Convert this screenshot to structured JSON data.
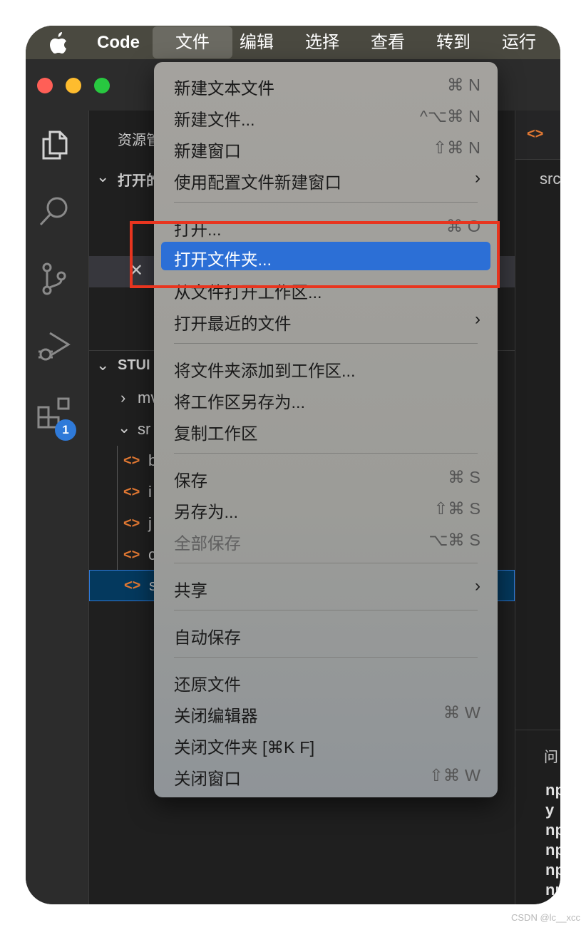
{
  "menubar": {
    "app_name": "Code",
    "items": [
      "文件",
      "编辑",
      "选择",
      "查看",
      "转到",
      "运行"
    ]
  },
  "sidebar": {
    "header": "资源管",
    "open_editors": "打开的",
    "workspace": "STUI",
    "folders": [
      "mv",
      "sr"
    ],
    "files": [
      "b",
      "i",
      "j",
      "c",
      "s"
    ],
    "badge_count": "1"
  },
  "editor": {
    "breadcrumb": "src",
    "panel_label": "问",
    "terminal_lines": [
      "np",
      "y",
      "np",
      "np",
      "np",
      "np"
    ]
  },
  "menu": {
    "items": [
      {
        "label": "新建文本文件",
        "shortcut": "⌘ N"
      },
      {
        "label": "新建文件...",
        "shortcut": "^⌥⌘ N"
      },
      {
        "label": "新建窗口",
        "shortcut": "⇧⌘ N"
      },
      {
        "label": "使用配置文件新建窗口",
        "shortcut": ""
      },
      {
        "label": "打开...",
        "shortcut": "⌘ O"
      },
      {
        "label": "打开文件夹...",
        "shortcut": ""
      },
      {
        "label": "从文件打开工作区...",
        "shortcut": ""
      },
      {
        "label": "打开最近的文件",
        "shortcut": ""
      },
      {
        "label": "将文件夹添加到工作区...",
        "shortcut": ""
      },
      {
        "label": "将工作区另存为...",
        "shortcut": ""
      },
      {
        "label": "复制工作区",
        "shortcut": ""
      },
      {
        "label": "保存",
        "shortcut": "⌘ S"
      },
      {
        "label": "另存为...",
        "shortcut": "⇧⌘ S"
      },
      {
        "label": "全部保存",
        "shortcut": "⌥⌘ S"
      },
      {
        "label": "共享",
        "shortcut": ""
      },
      {
        "label": "自动保存",
        "shortcut": ""
      },
      {
        "label": "还原文件",
        "shortcut": ""
      },
      {
        "label": "关闭编辑器",
        "shortcut": "⌘ W"
      },
      {
        "label": "关闭文件夹 [⌘K F]",
        "shortcut": ""
      },
      {
        "label": "关闭窗口",
        "shortcut": "⇧⌘ W"
      }
    ],
    "submenu_arrow": "›"
  },
  "colors": {
    "menubar_bg": "#4a4940",
    "menu_highlight": "#2c6fd6",
    "annotation_red": "#e8351f",
    "file_icon_orange": "#e37933"
  },
  "watermark": "CSDN @lc__xcc"
}
